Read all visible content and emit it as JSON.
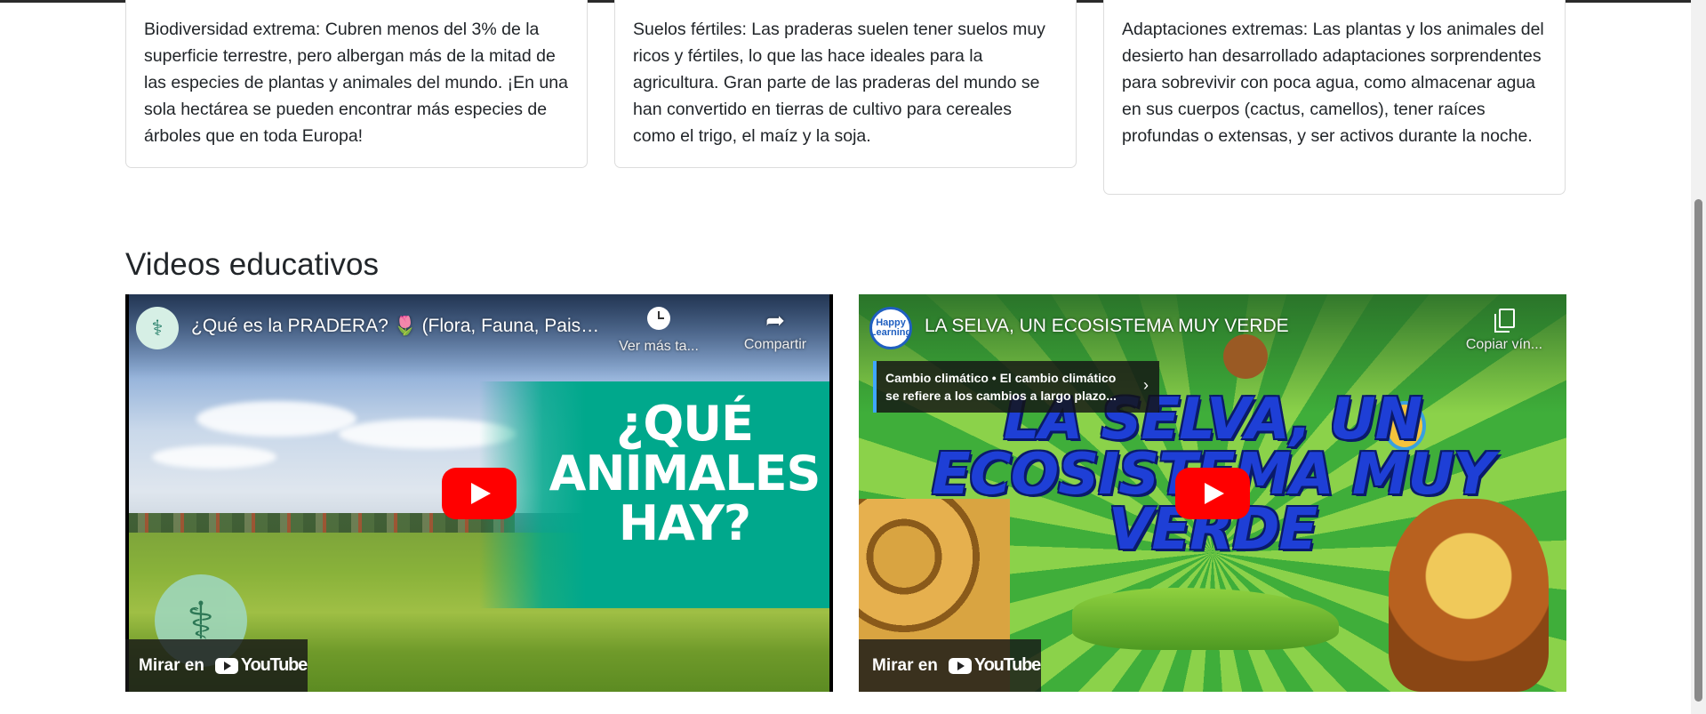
{
  "cards": [
    {
      "text": "Biodiversidad extrema: Cubren menos del 3% de la superficie terrestre, pero albergan más de la mitad de las especies de plantas y animales del mundo. ¡En una sola hectárea se pueden encontrar más especies de árboles que en toda Europa!"
    },
    {
      "text": "Suelos fértiles: Las praderas suelen tener suelos muy ricos y fértiles, lo que las hace ideales para la agricultura. Gran parte de las praderas del mundo se han convertido en tierras de cultivo para cereales como el trigo, el maíz y la soja."
    },
    {
      "text": "Adaptaciones extremas: Las plantas y los animales del desierto han desarrollado adaptaciones sorprendentes para sobrevivir con poca agua, como almacenar agua en sus cuerpos (cactus, camellos), tener raíces profundas o extensas, y ser activos durante la noche."
    }
  ],
  "section_title": "Videos educativos",
  "videos": [
    {
      "title": "¿Qué es la PRADERA? 🌷 (Flora, Fauna, Paisaje...",
      "thumb_text": "¿QUÉ ANIMALES HAY?",
      "watch_later": "Ver más ta...",
      "share": "Compartir",
      "watch_on": "Mirar en",
      "youtube": "YouTube"
    },
    {
      "title": "LA SELVA, UN ECOSISTEMA MUY VERDE",
      "channel_badge": "Happy Learning",
      "info_card": "Cambio climático • El cambio climático se refiere a los cambios a largo plazo...",
      "thumb_text": "LA SELVA, UN ECOSISTEMA MUY VERDE",
      "copy_link": "Copiar vín...",
      "watch_on": "Mirar en",
      "youtube": "YouTube"
    }
  ],
  "colors": {
    "play_red": "#ff0000",
    "teal": "#00a88c",
    "info_accent": "#3ea6ff"
  }
}
